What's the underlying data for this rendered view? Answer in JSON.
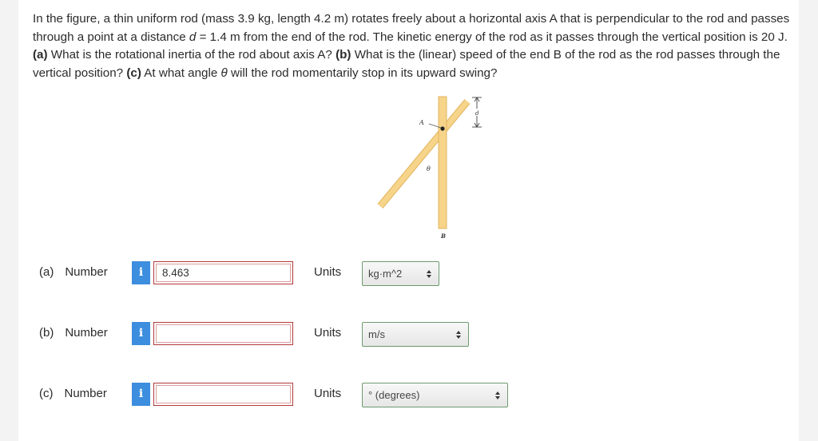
{
  "problem": {
    "intro": "In the figure, a thin uniform rod (mass 3.9 kg, length 4.2 m) rotates freely about a horizontal axis A that is perpendicular to the rod and passes through a point at a distance ",
    "d_symbol": "d",
    "after_d": " = 1.4 m from the end of the rod. The kinetic energy of the rod as it passes through the vertical position is 20 J. ",
    "part_a_tag": "(a)",
    "part_a_text": " What is the rotational inertia of the rod about axis A? ",
    "part_b_tag": "(b)",
    "part_b_text": " What is the (linear) speed of the end B of the rod as the rod passes through the vertical position? ",
    "part_c_tag": "(c)",
    "part_c_text_1": " At what angle ",
    "theta_symbol": "θ",
    "part_c_text_2": " will the rod momentarily stop in its upward swing?"
  },
  "figure": {
    "label_a": "A",
    "label_theta": "θ",
    "label_b": "B",
    "label_d": "d"
  },
  "answers": [
    {
      "part": "(a)",
      "number_label": "Number",
      "info": "i",
      "value": "8.463",
      "units_label": "Units",
      "unit": "kg·m^2"
    },
    {
      "part": "(b)",
      "number_label": "Number",
      "info": "i",
      "value": "",
      "units_label": "Units",
      "unit": "m/s"
    },
    {
      "part": "(c)",
      "number_label": "Number",
      "info": "i",
      "value": "",
      "units_label": "Units",
      "unit": "° (degrees)"
    }
  ],
  "colors": {
    "rod": "#f6d48a",
    "rod_edge": "#e2b45e",
    "info_button": "#3d8ede",
    "answer_border": "#b23a3a",
    "select_border": "#6e9a6e"
  }
}
